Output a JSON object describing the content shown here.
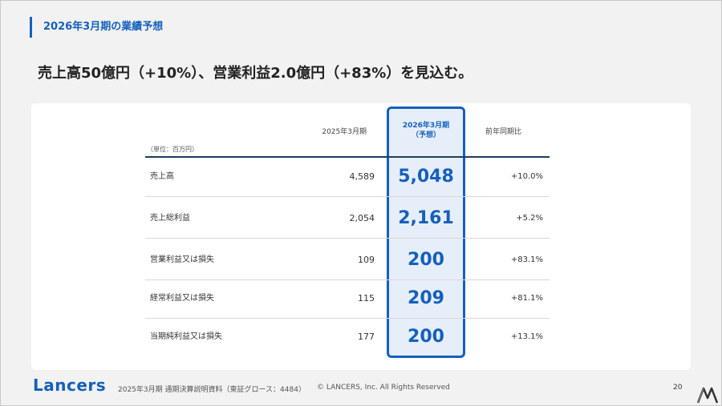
{
  "section_title": "2026年3月期の業績予想",
  "headline": "売上高50億円（+10%）、営業利益2.0億円（+83%）を見込む。",
  "table": {
    "unit": "（単位：百万円）",
    "col_prev": "2025年3月期",
    "col_forecast_line1": "2026年3月期",
    "col_forecast_line2": "（予想）",
    "col_yoy": "前年同期比",
    "rows": [
      {
        "label": "売上高",
        "prev": "4,589",
        "forecast": "5,048",
        "yoy": "+10.0%"
      },
      {
        "label": "売上総利益",
        "prev": "2,054",
        "forecast": "2,161",
        "yoy": "+5.2%"
      },
      {
        "label": "営業利益又は損失",
        "prev": "109",
        "forecast": "200",
        "yoy": "+83.1%"
      },
      {
        "label": "経常利益又は損失",
        "prev": "115",
        "forecast": "209",
        "yoy": "+81.1%"
      },
      {
        "label": "当期純利益又は損失",
        "prev": "177",
        "forecast": "200",
        "yoy": "+13.1%"
      }
    ]
  },
  "footer": {
    "logo": "Lancers",
    "note": "2025年3月期 通期決算説明資料（東証グロース：4484）",
    "copyright": "© LANCERS, Inc. All Rights Reserved",
    "page_number": "20"
  },
  "colors": {
    "accent": "#1560bd",
    "header_line": "#1e3d5c"
  },
  "icons": {
    "corner": "itmedia-logo-icon"
  }
}
